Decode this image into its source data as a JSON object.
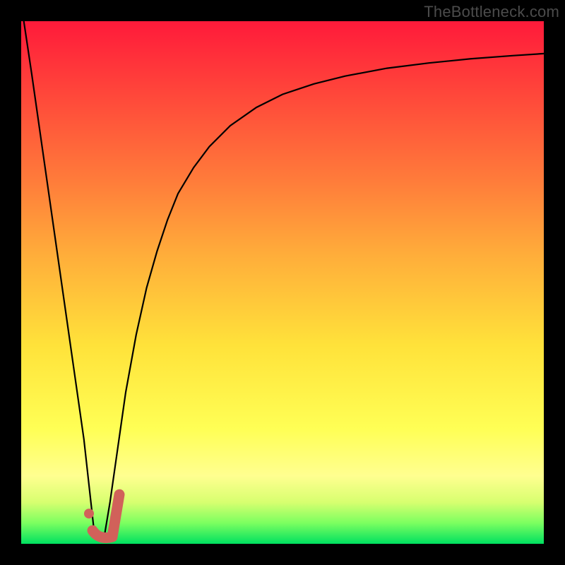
{
  "watermark": "TheBottleneck.com",
  "colors": {
    "background": "#000000",
    "curve": "#000000",
    "marker_stroke": "#d1615a",
    "marker_fill": "#d1615a",
    "gradient_top": "#ff1a3a",
    "gradient_bottom": "#00e060"
  },
  "chart_data": {
    "type": "line",
    "title": "",
    "xlabel": "",
    "ylabel": "",
    "xlim": [
      0,
      100
    ],
    "ylim": [
      0,
      100
    ],
    "grid": false,
    "series": [
      {
        "name": "left-branch",
        "x": [
          0.5,
          2,
          4,
          6,
          8,
          10,
          12,
          14
        ],
        "values": [
          100,
          90,
          76,
          62,
          48,
          34,
          20,
          2
        ]
      },
      {
        "name": "right-branch",
        "x": [
          16,
          17,
          18,
          19,
          20,
          22,
          24,
          26,
          28,
          30,
          33,
          36,
          40,
          45,
          50,
          56,
          62,
          70,
          78,
          86,
          94,
          100
        ],
        "values": [
          2,
          8,
          15,
          22,
          29,
          40,
          49,
          56,
          62,
          67,
          72,
          76,
          80,
          83.5,
          86,
          88,
          89.5,
          91,
          92,
          92.8,
          93.4,
          93.8
        ]
      }
    ],
    "marker": {
      "name": "selected-point",
      "shape": "J-check",
      "x": 15,
      "y": 2,
      "color": "#d1615a"
    }
  }
}
